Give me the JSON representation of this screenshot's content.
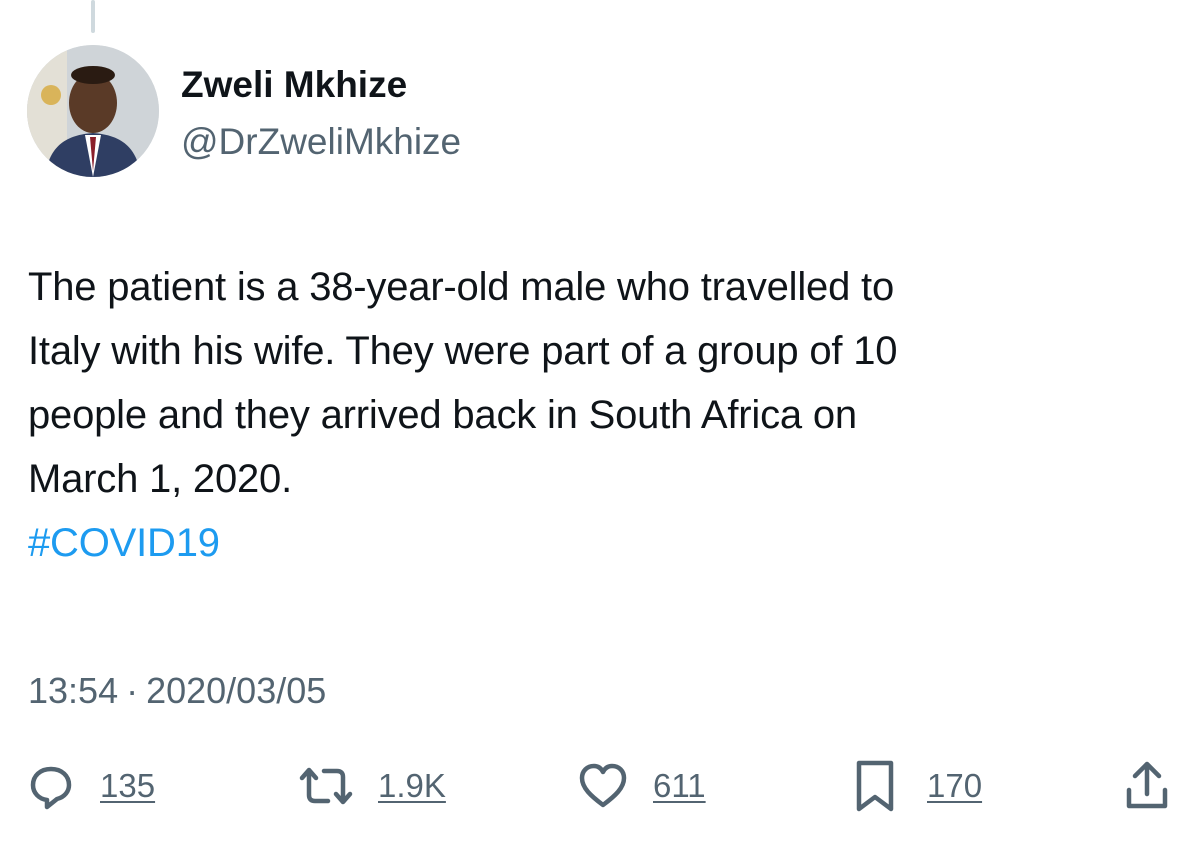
{
  "tweet": {
    "author": {
      "name": "Zweli Mkhize",
      "handle": "@DrZweliMkhize"
    },
    "text_lines": [
      "The patient is a 38-year-old male who travelled to",
      "Italy with his wife. They were part of a group of 10",
      "people and they arrived back in South Africa on",
      "March 1, 2020."
    ],
    "hashtag": "#COVID19",
    "time": "13:54",
    "separator": "·",
    "date": "2020/03/05"
  },
  "actions": {
    "replies": "135",
    "retweets": "1.9K",
    "likes": "611",
    "bookmarks": "170"
  },
  "colors": {
    "text": "#0f1419",
    "secondary": "#536471",
    "link": "#1d9bf0"
  },
  "icons": {
    "reply": "reply-icon",
    "retweet": "retweet-icon",
    "like": "heart-icon",
    "bookmark": "bookmark-icon",
    "share": "share-icon"
  }
}
